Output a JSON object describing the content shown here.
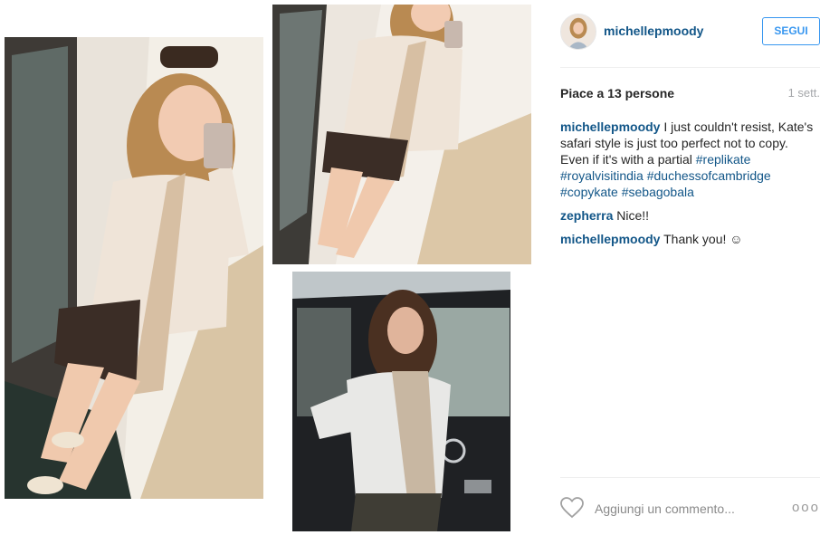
{
  "post": {
    "username": "michellepmoody",
    "follow_label": "SEGUI",
    "likes_text": "Piace a 13 persone",
    "time_text": "1 sett."
  },
  "comments": [
    {
      "user": "michellepmoody",
      "text": "I just couldn't resist, Kate's safari style is just too perfect not to copy. Even if it's with a partial",
      "tags": [
        "#replikate",
        "#royalvisitindia",
        "#duchessofcambridge",
        "#copykate",
        "#sebagobala"
      ]
    },
    {
      "user": "zepherra",
      "text": "Nice!!"
    },
    {
      "user": "michellepmoody",
      "text": "Thank you! ☺"
    }
  ],
  "input": {
    "placeholder": "Aggiungi un commento..."
  },
  "more_label": "ooo",
  "colors": {
    "link": "#125688",
    "button": "#3897f0",
    "divider": "#efefef"
  },
  "icons": {
    "like": "heart-icon",
    "more": "more-options-icon"
  }
}
